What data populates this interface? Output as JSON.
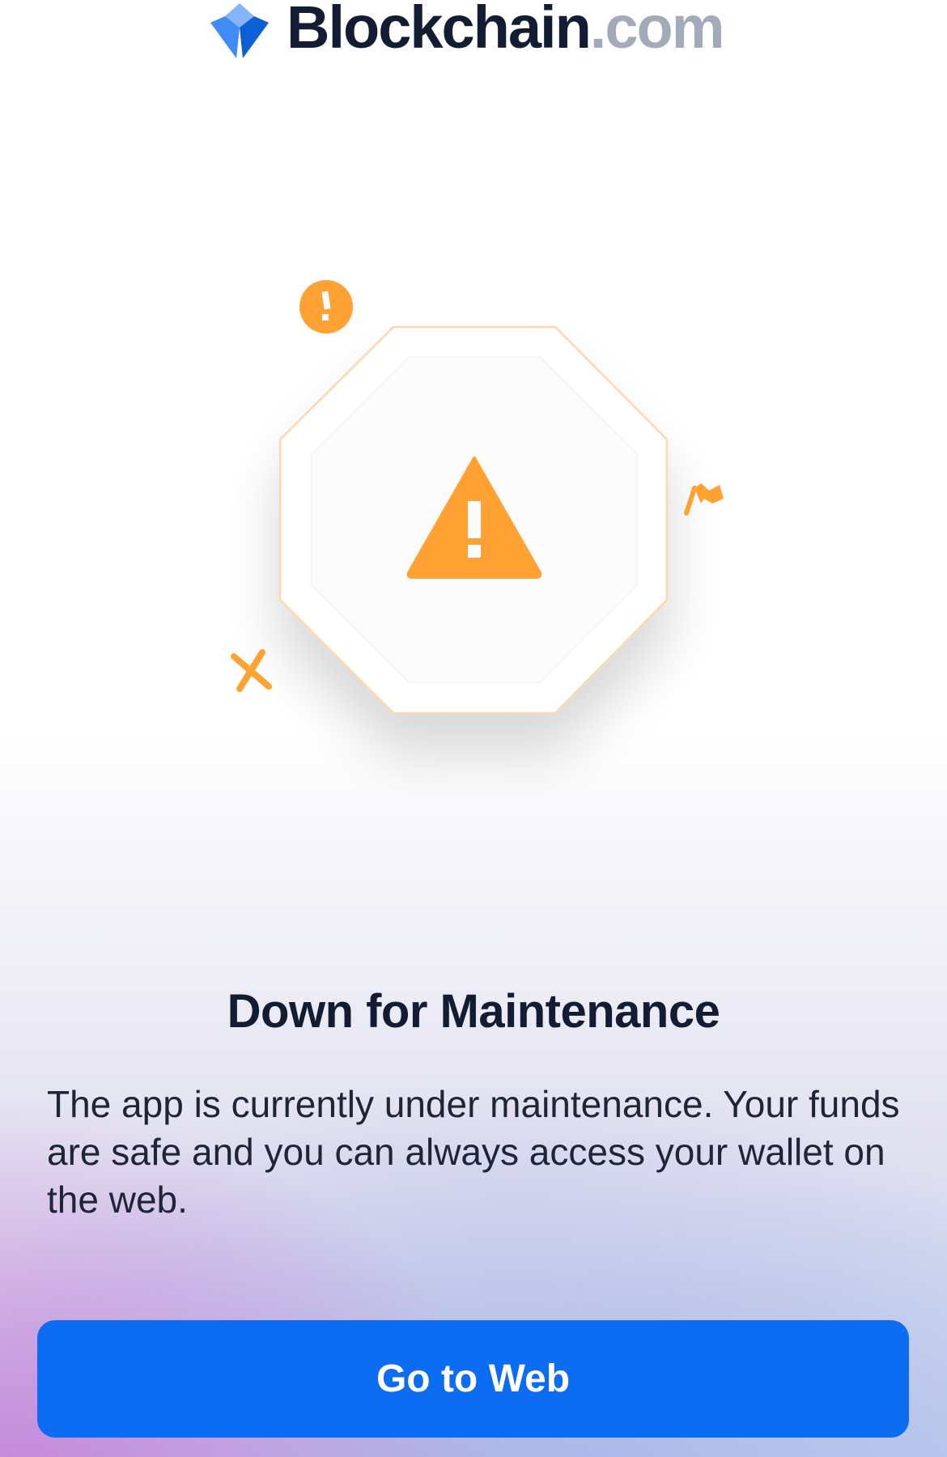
{
  "brand": {
    "name": "Blockchain",
    "tld": ".com",
    "icon": "blockchain-cube-logo-icon",
    "icon_color": "#0c6cf2"
  },
  "illustration": {
    "main_icon": "warning-triangle-icon",
    "decorations": [
      "exclamation-circle-icon",
      "flag-icon",
      "x-mark-icon"
    ],
    "accent_color": "#ffa133"
  },
  "main": {
    "title": "Down for Maintenance",
    "description": "The app is currently under maintenance. Your funds are safe and you can always access your wallet on the web."
  },
  "actions": {
    "primary_label": "Go to Web",
    "primary_color": "#0c6cf2"
  }
}
